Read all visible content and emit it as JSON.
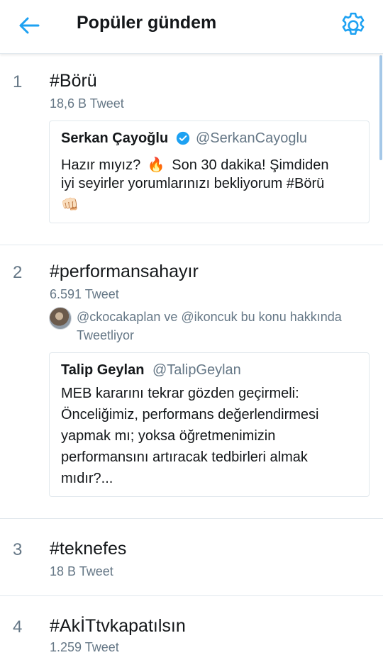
{
  "header": {
    "title": "Popüler gündem",
    "back_icon": "arrow-left-icon",
    "settings_icon": "gear-icon",
    "accent": "#1da1f2"
  },
  "trends": [
    {
      "rank": "1",
      "name": "#Börü",
      "count": "18,6 B Tweet",
      "tweet": {
        "author": "Serkan Çayoğlu",
        "handle": "@SerkanCayoglu",
        "verified": true,
        "line1_a": "Hazır mıyız?",
        "line1_emoji": "🔥",
        "line1_b": "Son 30 dakika! Şimdiden",
        "line2": "iyi seyirler yorumlarınızı bekliyorum #Börü",
        "line3": "👊🏻"
      }
    },
    {
      "rank": "2",
      "name": "#performansahayır",
      "count": "6.591 Tweet",
      "social_line1": "@ckocakaplan ve @ikoncuk bu konu hakkında",
      "social_line2": "Tweetliyor",
      "tweet": {
        "author": "Talip Geylan",
        "handle": "@TalipGeylan",
        "lines": [
          "MEB kararını tekrar gözden geçirmeli:",
          "Önceliğimiz, performans değerlendirmesi",
          "yapmak mı; yoksa öğretmenimizin",
          "performansını artıracak tedbirleri almak",
          "mıdır?..."
        ]
      }
    },
    {
      "rank": "3",
      "name": "#teknefes",
      "count": "18 B Tweet"
    },
    {
      "rank": "4",
      "name": "#AkİTtvkapatılsın",
      "count": "1.259 Tweet"
    }
  ]
}
